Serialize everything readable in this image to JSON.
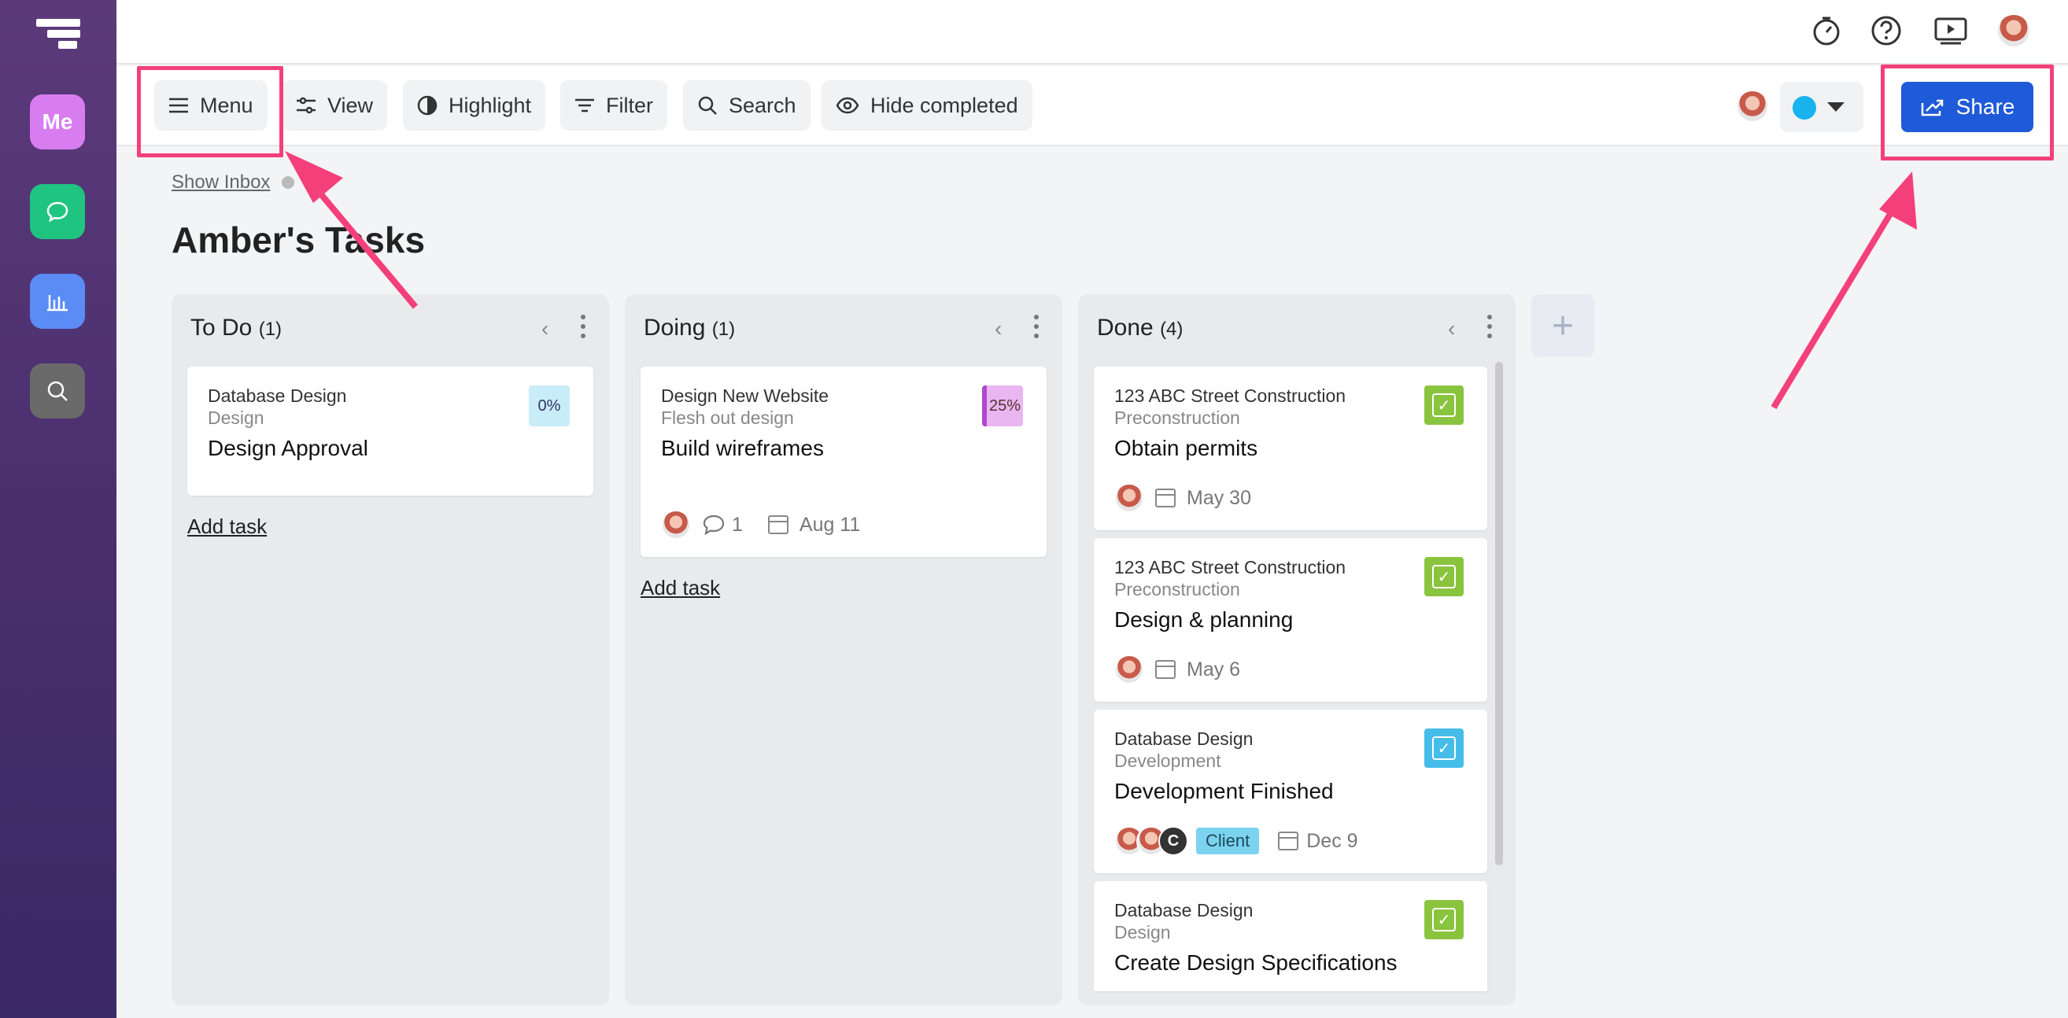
{
  "sidebar": {
    "items": [
      {
        "label": "Me",
        "color": "#d77df0"
      },
      {
        "icon": "chat-icon",
        "color": "#1fc481"
      },
      {
        "icon": "bar-chart-icon",
        "color": "#5b8bf5"
      },
      {
        "icon": "search-icon",
        "color": "#6a6a6a"
      }
    ]
  },
  "toolbar": {
    "menu_label": "Menu",
    "view_label": "View",
    "highlight_label": "Highlight",
    "filter_label": "Filter",
    "search_label": "Search",
    "hide_completed_label": "Hide completed",
    "share_label": "Share",
    "status_color": "#19b3ee"
  },
  "main": {
    "show_inbox": "Show Inbox",
    "title": "Amber's Tasks"
  },
  "columns": [
    {
      "name": "To Do",
      "count": "(1)",
      "cards": [
        {
          "project": "Database Design",
          "section": "Design",
          "title": "Design Approval",
          "progress": "0%"
        }
      ],
      "add_task": "Add task"
    },
    {
      "name": "Doing",
      "count": "(1)",
      "cards": [
        {
          "project": "Design New Website",
          "section": "Flesh out design",
          "title": "Build wireframes",
          "progress": "25%",
          "comments": "1",
          "date": "Aug 11"
        }
      ],
      "add_task": "Add task"
    },
    {
      "name": "Done",
      "count": "(4)",
      "cards": [
        {
          "project": "123 ABC Street Construction",
          "section": "Preconstruction",
          "title": "Obtain permits",
          "date": "May 30",
          "check_color": "#8ac43f"
        },
        {
          "project": "123 ABC Street Construction",
          "section": "Preconstruction",
          "title": "Design & planning",
          "date": "May 6",
          "check_color": "#8ac43f"
        },
        {
          "project": "Database Design",
          "section": "Development",
          "title": "Development Finished",
          "tag": "Client",
          "avatar_letter": "C",
          "date": "Dec 9",
          "check_color": "#45bde8"
        },
        {
          "project": "Database Design",
          "section": "Design",
          "title": "Create Design Specifications",
          "check_color": "#8ac43f"
        }
      ]
    }
  ]
}
